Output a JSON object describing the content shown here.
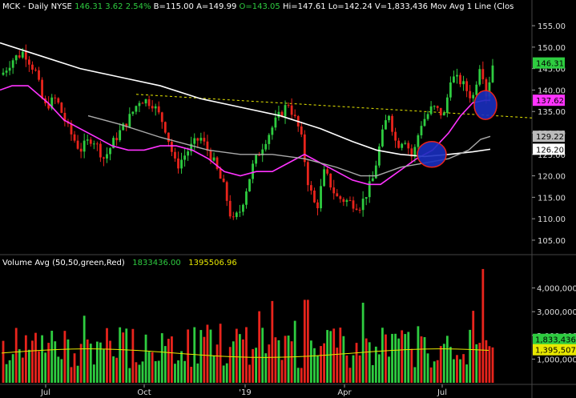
{
  "header": {
    "symbol": "MCK - Daily  NYSE",
    "last": "146.31",
    "chg": "3.62",
    "pct": "2.54%",
    "b": "B=115.00",
    "a": "A=149.99",
    "o": "O=143.05",
    "hi": "Hi=147.61",
    "lo": "Lo=142.24",
    "v": "V=1,833,436",
    "mavg": "Mov Avg 1 Line (Clos"
  },
  "volume_header": {
    "label": "Volume Avg (50,50,green,Red)",
    "v1": "1833436.00",
    "v2": "1395506.96"
  },
  "colors": {
    "background": "#000000",
    "up_candle": "#2ecc40",
    "down_candle": "#e8241c",
    "ma50": "#ff33ff",
    "ma200": "#ffffff",
    "ma_gray": "#aaaaaa",
    "trendline": "#e8e800",
    "circle_fill": "#1a2fbf",
    "circle_edge": "#e8241c",
    "volume_avg": "#e8e800"
  },
  "chart_data": [
    {
      "type": "candlestick",
      "title": "MCK - Daily NYSE",
      "x_labels": [
        "Jul",
        "Oct",
        "'19",
        "Apr",
        "Jul"
      ],
      "y_ticks": [
        105,
        110,
        115,
        120,
        125,
        130,
        135,
        140,
        145,
        150,
        155
      ],
      "ylim": [
        102,
        158
      ],
      "price_tags": [
        {
          "value": 146.31,
          "label": "146.31",
          "bg": "#2ecc40",
          "fg": "#000000"
        },
        {
          "value": 137.62,
          "label": "137.62",
          "bg": "#ff33ff",
          "fg": "#000000"
        },
        {
          "value": 129.22,
          "label": "129.22",
          "bg": "#bbbbbb",
          "fg": "#000000"
        },
        {
          "value": 126.2,
          "label": "126.20",
          "bg": "#ffffff",
          "fg": "#000000"
        }
      ],
      "ma200_last": 126.2,
      "ma_gray_last": 129.22,
      "ma50_last": 137.62,
      "last_close": 146.31
    },
    {
      "type": "bar",
      "title": "Volume",
      "y_ticks": [
        "1,000,000",
        "2,000,000",
        "3,000,000",
        "4,000,000"
      ],
      "tags": [
        {
          "label": "1,833,436",
          "bg": "#2ecc40"
        },
        {
          "label": "1,395,507",
          "bg": "#e8e800"
        }
      ]
    }
  ]
}
